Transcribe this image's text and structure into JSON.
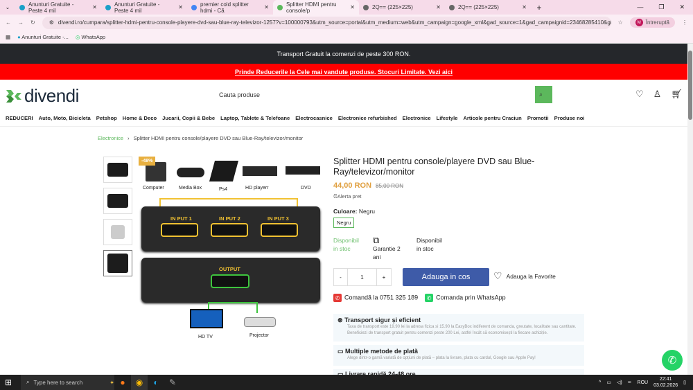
{
  "browser": {
    "tabs": [
      {
        "label": "Anunturi Gratuite - Peste 4 mil"
      },
      {
        "label": "Anunturi Gratuite - Peste 4 mil"
      },
      {
        "label": "premier cold splitter hdmi - Că"
      },
      {
        "label": "Splitter HDMI pentru console/p",
        "active": true
      },
      {
        "label": "2Q== (225×225)"
      },
      {
        "label": "2Q== (225×225)"
      }
    ],
    "url": "divendi.ro/cumpara/splitter-hdmi-pentru-console-playere-dvd-sau-blue-ray-televizor-1257?v=100000793&utm_source=portal&utm_medium=web&utm_campaign=google_xml&gad_source=1&gad_campaignid=23468285410&gbraid=0AAAAAqc9Tau...",
    "profile": "Întreruptă",
    "profile_initial": "M",
    "bookmarks": [
      "Anunturi Gratuite -...",
      "WhatsApp"
    ]
  },
  "site": {
    "top_banner": "Transport Gratuit la comenzi de peste 300 RON.",
    "promo_banner": "Prinde Reducerile la Cele mai vandute produse. Stocuri Limitate. Vezi aici",
    "logo": "divendi",
    "search_placeholder": "Cauta produse",
    "nav": [
      "REDUCERI",
      "Auto, Moto, Bicicleta",
      "Petshop",
      "Home & Deco",
      "Jucarii, Copii & Bebe",
      "Laptop, Tablete & Telefoane",
      "Electrocasnice",
      "Electronice refurbished",
      "Electronice",
      "Lifestyle",
      "Articole pentru Craciun",
      "Promotii",
      "Produse noi"
    ],
    "breadcrumb": {
      "parent": "Electronice",
      "sep": "›",
      "current": "Splitter HDMI pentru console/playere DVD sau Blue-Ray/televizor/monitor"
    }
  },
  "image": {
    "discount": "-48%",
    "devices": [
      "Computer",
      "Media Box",
      "Ps4",
      "HD playerr",
      "DVD"
    ],
    "inputs": [
      "IN PUT 1",
      "IN PUT 2",
      "IN PUT 3"
    ],
    "output": "OUTPUT",
    "outputs": [
      "HD  TV",
      "Projector"
    ]
  },
  "product": {
    "title": "Splitter HDMI pentru console/playere DVD sau Blue-Ray/televizor/monitor",
    "price": "44,00 RON",
    "old_price": "85,00 RON",
    "alert": "Alerta pret",
    "color_label": "Culoare:",
    "color_value": "Negru",
    "color_option": "Negru",
    "avail1_a": "Disponibil",
    "avail1_b": "in stoc",
    "warranty_a": "Garantie 2",
    "warranty_b": "ani",
    "avail2_a": "Disponibil",
    "avail2_b": "in stoc",
    "qty": "1",
    "minus": "-",
    "plus": "+",
    "add_to_cart": "Adauga in cos",
    "favorite": "Adauga la Favorite",
    "phone": "Comandă la 0751 325 189",
    "whatsapp": "Comanda prin WhatsApp"
  },
  "info": [
    {
      "title": "Transport sigur și eficient",
      "text": "Taxa de transport este 19.90 lei la adresa fizica si 15.90 la EasyBox indiferent de comanda, greutate, localitate sau cantitate. Beneficiezi de transport gratuit pentru comenzi peste 200 Lei, astfel încât să economisești la fiecare achiziție."
    },
    {
      "title": "Multiple metode de plată",
      "text": "Alege dintr-o gamă variată de opțiuni de plată – plata la livrare, plata cu cardul, Google sau Apple Pay!"
    },
    {
      "title": "Livrare rapidă 24-48 ore",
      "text": ""
    }
  ],
  "taskbar": {
    "search": "Type here to search",
    "lang": "ROU",
    "time": "22:41",
    "date": "03.02.2026"
  }
}
